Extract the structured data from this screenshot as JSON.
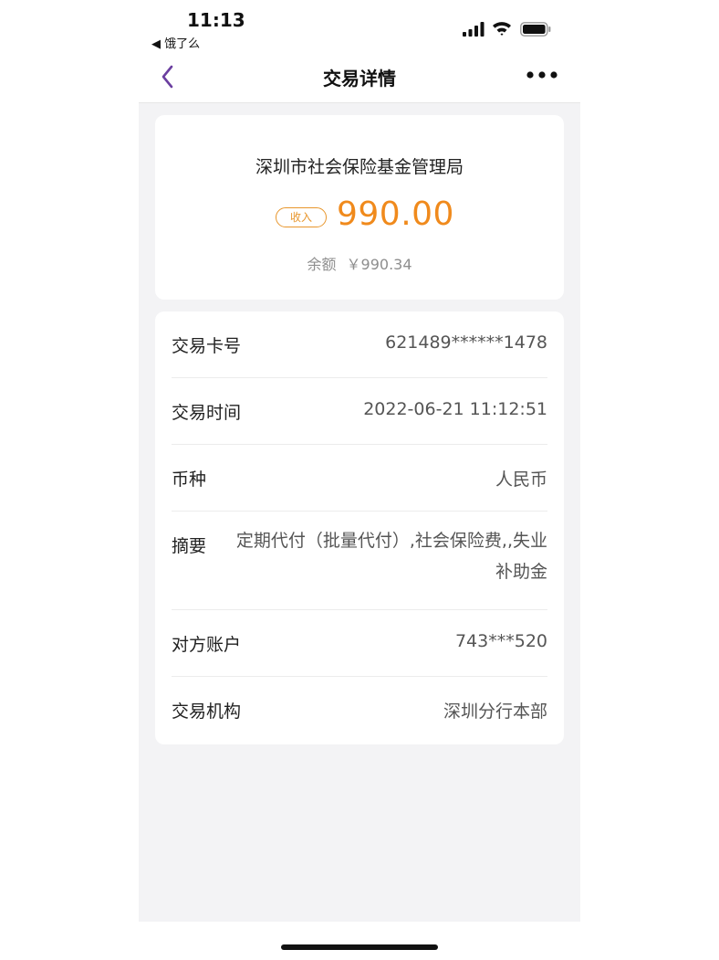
{
  "status_bar": {
    "time": "11:13",
    "back_app": "◀ 饿了么",
    "icons": [
      "signal-icon",
      "wifi-icon",
      "battery-icon"
    ]
  },
  "nav": {
    "title": "交易详情",
    "back_icon": "chevron-left-icon",
    "more_icon": "more-horizontal-icon",
    "accent_color": "#6b3fa0"
  },
  "summary": {
    "payer": "深圳市社会保险基金管理局",
    "badge": "收入",
    "amount": "990.00",
    "balance_label": "余额",
    "balance_value": "￥990.34",
    "amount_color": "#f08a1c"
  },
  "details": [
    {
      "label": "交易卡号",
      "value": "621489******1478"
    },
    {
      "label": "交易时间",
      "value": "2022-06-21 11:12:51"
    },
    {
      "label": "币种",
      "value": "人民币"
    },
    {
      "label": "摘要",
      "value": "定期代付（批量代付）,社会保险费,,失业补助金"
    },
    {
      "label": "对方账户",
      "value": "743***520"
    },
    {
      "label": "交易机构",
      "value": "深圳分行本部"
    }
  ]
}
